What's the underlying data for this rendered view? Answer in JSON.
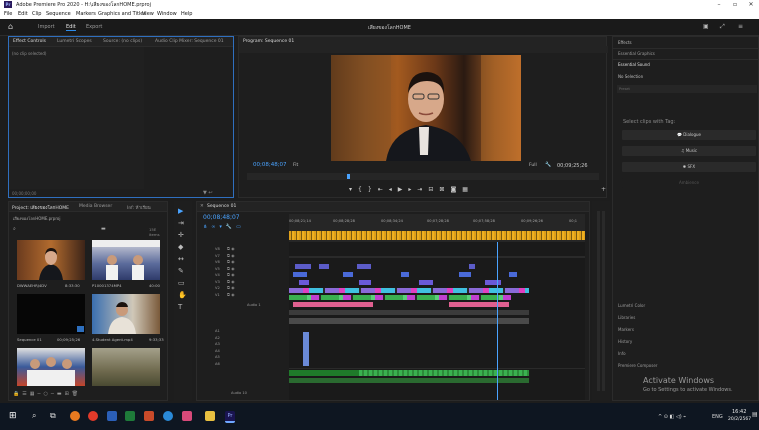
{
  "window": {
    "title": "Adobe Premiere Pro 2020 - H:\\เสียงของโลกHOME.prproj",
    "app_icon": "Pr"
  },
  "menu": [
    "File",
    "Edit",
    "Clip",
    "Sequence",
    "Markers",
    "Graphics and Titles",
    "View",
    "Window",
    "Help"
  ],
  "workspaces": {
    "items": [
      "Import",
      "Edit",
      "Export"
    ],
    "active": "Edit",
    "project_title": "เสียงของโลกHOME"
  },
  "effect_controls": {
    "tabs": [
      "Effect Controls",
      "Lumetri Scopes",
      "Source: (no clips)",
      "Audio Clip Mixer: Sequence 01"
    ],
    "empty_text": "(no clip selected)",
    "timecode": "00;00;00;00"
  },
  "program_monitor": {
    "tab": "Program: Sequence 01",
    "timecode": "00;08;48;07",
    "fit": "Fit",
    "quality": "Full",
    "duration": "00;09;25;26"
  },
  "right_panel": {
    "tabs": [
      "Effects",
      "Essential Graphics",
      "Essential Sound"
    ],
    "no_selection": "No Selection",
    "preset_label": "Preset",
    "tag_prompt": "Select clips with Tag:",
    "tags": [
      "Dialogue",
      "Music",
      "SFX",
      "Ambience"
    ],
    "lower_items": [
      "Lumetri Color",
      "Libraries",
      "Markers",
      "History",
      "Info",
      "Premiere Composer"
    ]
  },
  "project": {
    "tabs": [
      "Project: เสียงของโลกHOME",
      "Media Browser",
      "Inf: ห้าเรียน"
    ],
    "file": "เสียงของโลกHOME.prproj",
    "item_count": "15E items",
    "items": [
      {
        "name": "DWWAEHRJ4DV",
        "dur": "8:33:30"
      },
      {
        "name": "P10001374MP4",
        "dur": "40:00"
      },
      {
        "name": "Sequence 01",
        "dur": "00;09;25;26"
      },
      {
        "name": "4.Student Agent.mp4",
        "dur": "9:33;33"
      },
      {
        "name": "",
        "dur": ""
      },
      {
        "name": "",
        "dur": ""
      }
    ]
  },
  "timeline": {
    "tab": "Sequence 01",
    "timecode": "00;08;48;07",
    "ruler": [
      "00;08;21;14",
      "00;08;28;28",
      "00;08;34;24",
      "00;07;28;28",
      "00;07;58;28",
      "00;09;26;26",
      "00;1"
    ],
    "video_tracks": [
      "V8",
      "V7",
      "V6",
      "V5",
      "V4",
      "V3",
      "V2",
      "V1"
    ],
    "audio_tracks": [
      "A1",
      "A2",
      "A3",
      "A4",
      "A5",
      "A6"
    ],
    "audio_label": "Audio 1",
    "audio_label_2": "Audio 10"
  },
  "activate": {
    "title": "Activate Windows",
    "subtitle": "Go to Settings to activate Windows."
  },
  "taskbar": {
    "time": "16:42",
    "date": "20/2/2567",
    "lang": "ENG"
  }
}
